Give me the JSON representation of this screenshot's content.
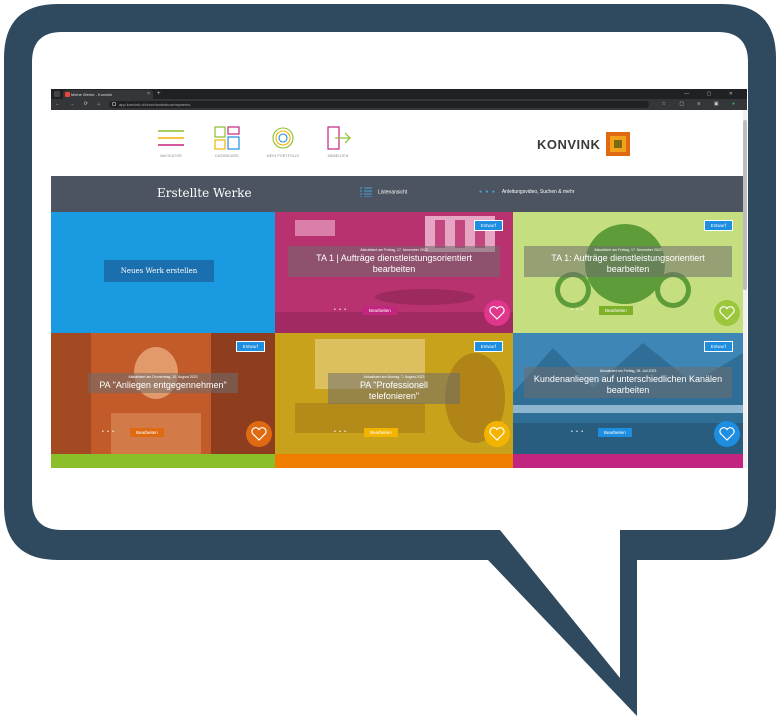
{
  "browser": {
    "tab_title": "Meine Werke - Konvink",
    "tab_close": "×",
    "new_tab": "+",
    "url": "app.konvink.ch/core/workshow/mywerks",
    "nav_buttons": "← → ⟳ ⌂",
    "ext_icons": "☆ ▢ ≡ ▣",
    "ext_dot": "●",
    "window_controls": "— ▢ ✕"
  },
  "header": {
    "nav": [
      {
        "label": "NAVIGATOR"
      },
      {
        "label": "DASHBOARD"
      },
      {
        "label": "MEIN PORTFOLIO"
      },
      {
        "label": "ABMELDEN"
      }
    ],
    "logo_text": "KONVINK"
  },
  "titlebar": {
    "title": "Erstellte Werke",
    "list_view": "Listenansicht",
    "help_dots": "● ● ●",
    "help": "Anleitungsvideo, Suchen & mehr"
  },
  "new_work": "Neues Werk erstellen",
  "tiles": [
    {
      "badge": "Entwurf",
      "updated": "Aktualisiert am Freitag, 17. November 2023",
      "title_lines": [
        "TA 1 | Aufträge dienstleistungsorientiert",
        "bearbeiten"
      ],
      "more": "• • •",
      "edit": "Bearbeiten",
      "colors": {
        "tint": "#c2257f",
        "button": "#c2257f",
        "heart": "#e0368b"
      }
    },
    {
      "badge": "Entwurf",
      "updated": "Aktualisiert am Freitag, 17. November 2023",
      "title_lines": [
        "TA 1: Aufträge dienstleistungsorientiert",
        "bearbeiten"
      ],
      "more": "• • •",
      "edit": "Bearbeiten",
      "colors": {
        "tint": "#b9d86a",
        "button": "#7fb02a",
        "heart": "#9cc63b"
      }
    },
    {
      "badge": "Entwurf",
      "updated": "Aktualisiert am Donnerstag, 10. August 2023",
      "title_lines": [
        "PA \"Anliegen entgegennehmen\""
      ],
      "more": "• • •",
      "edit": "Bearbeiten",
      "colors": {
        "tint": "#c25a2a",
        "button": "#e06a12",
        "heart": "#e06a12"
      }
    },
    {
      "badge": "Entwurf",
      "updated": "Aktualisiert am Montag, 7. August 2023",
      "title_lines": [
        "PA \"Professionell telefonieren\""
      ],
      "more": "• • •",
      "edit": "Bearbeiten",
      "colors": {
        "tint": "#c9a21c",
        "button": "#f2b400",
        "heart": "#f2b400"
      }
    },
    {
      "badge": "Entwurf",
      "updated": "Aktualisiert am Freitag, 28. Juli 2023",
      "title_lines": [
        "Kundenanliegen auf unterschiedlichen Kanälen",
        "bearbeiten"
      ],
      "more": "• • •",
      "edit": "Bearbeiten",
      "colors": {
        "tint": "#3e86b5",
        "button": "#1e8ee0",
        "heart": "#1e8ee0"
      }
    }
  ],
  "strips": {
    "colors": [
      "#8bbf2a",
      "#ef7d00",
      "#c2257f"
    ]
  }
}
